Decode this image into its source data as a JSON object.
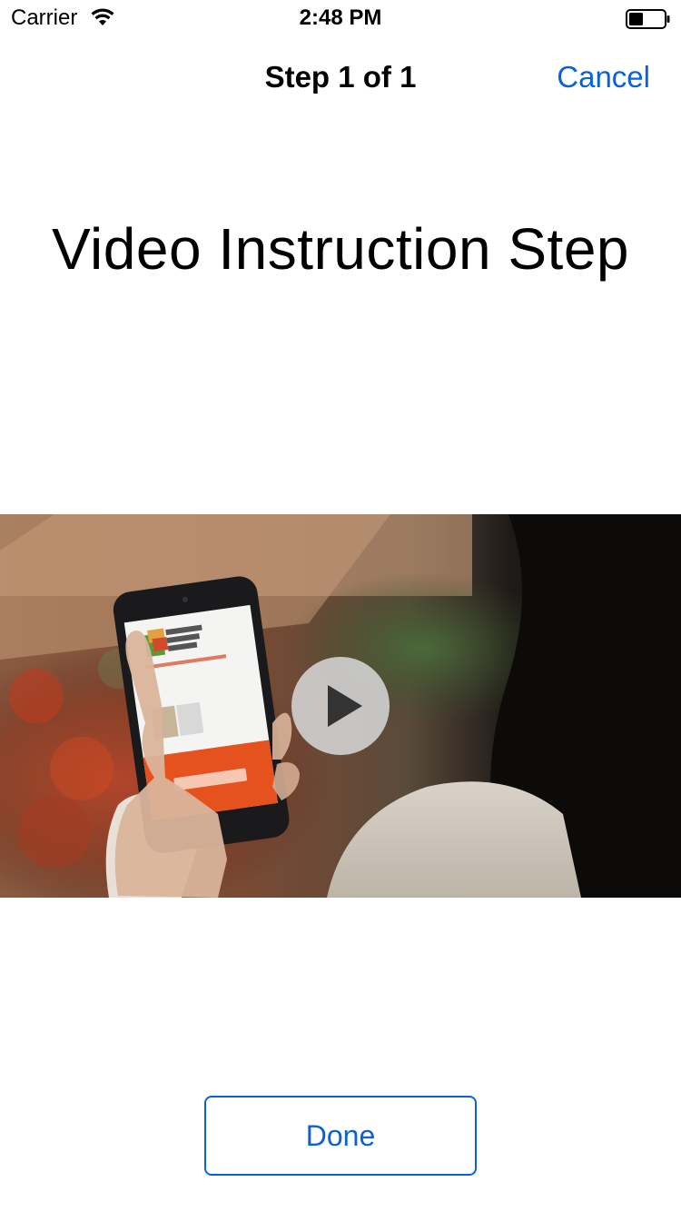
{
  "status_bar": {
    "carrier": "Carrier",
    "time": "2:48 PM",
    "wifi_icon": "wifi-icon",
    "battery_icon": "battery-icon"
  },
  "nav": {
    "title": "Step 1 of 1",
    "cancel_label": "Cancel"
  },
  "step": {
    "title": "Video Instruction Step"
  },
  "video": {
    "thumbnail": "person holding phone showing study app welcome screen",
    "play_icon": "play-icon"
  },
  "footer": {
    "done_label": "Done"
  },
  "colors": {
    "accent": "#0a62d6",
    "background": "#ffffff"
  }
}
